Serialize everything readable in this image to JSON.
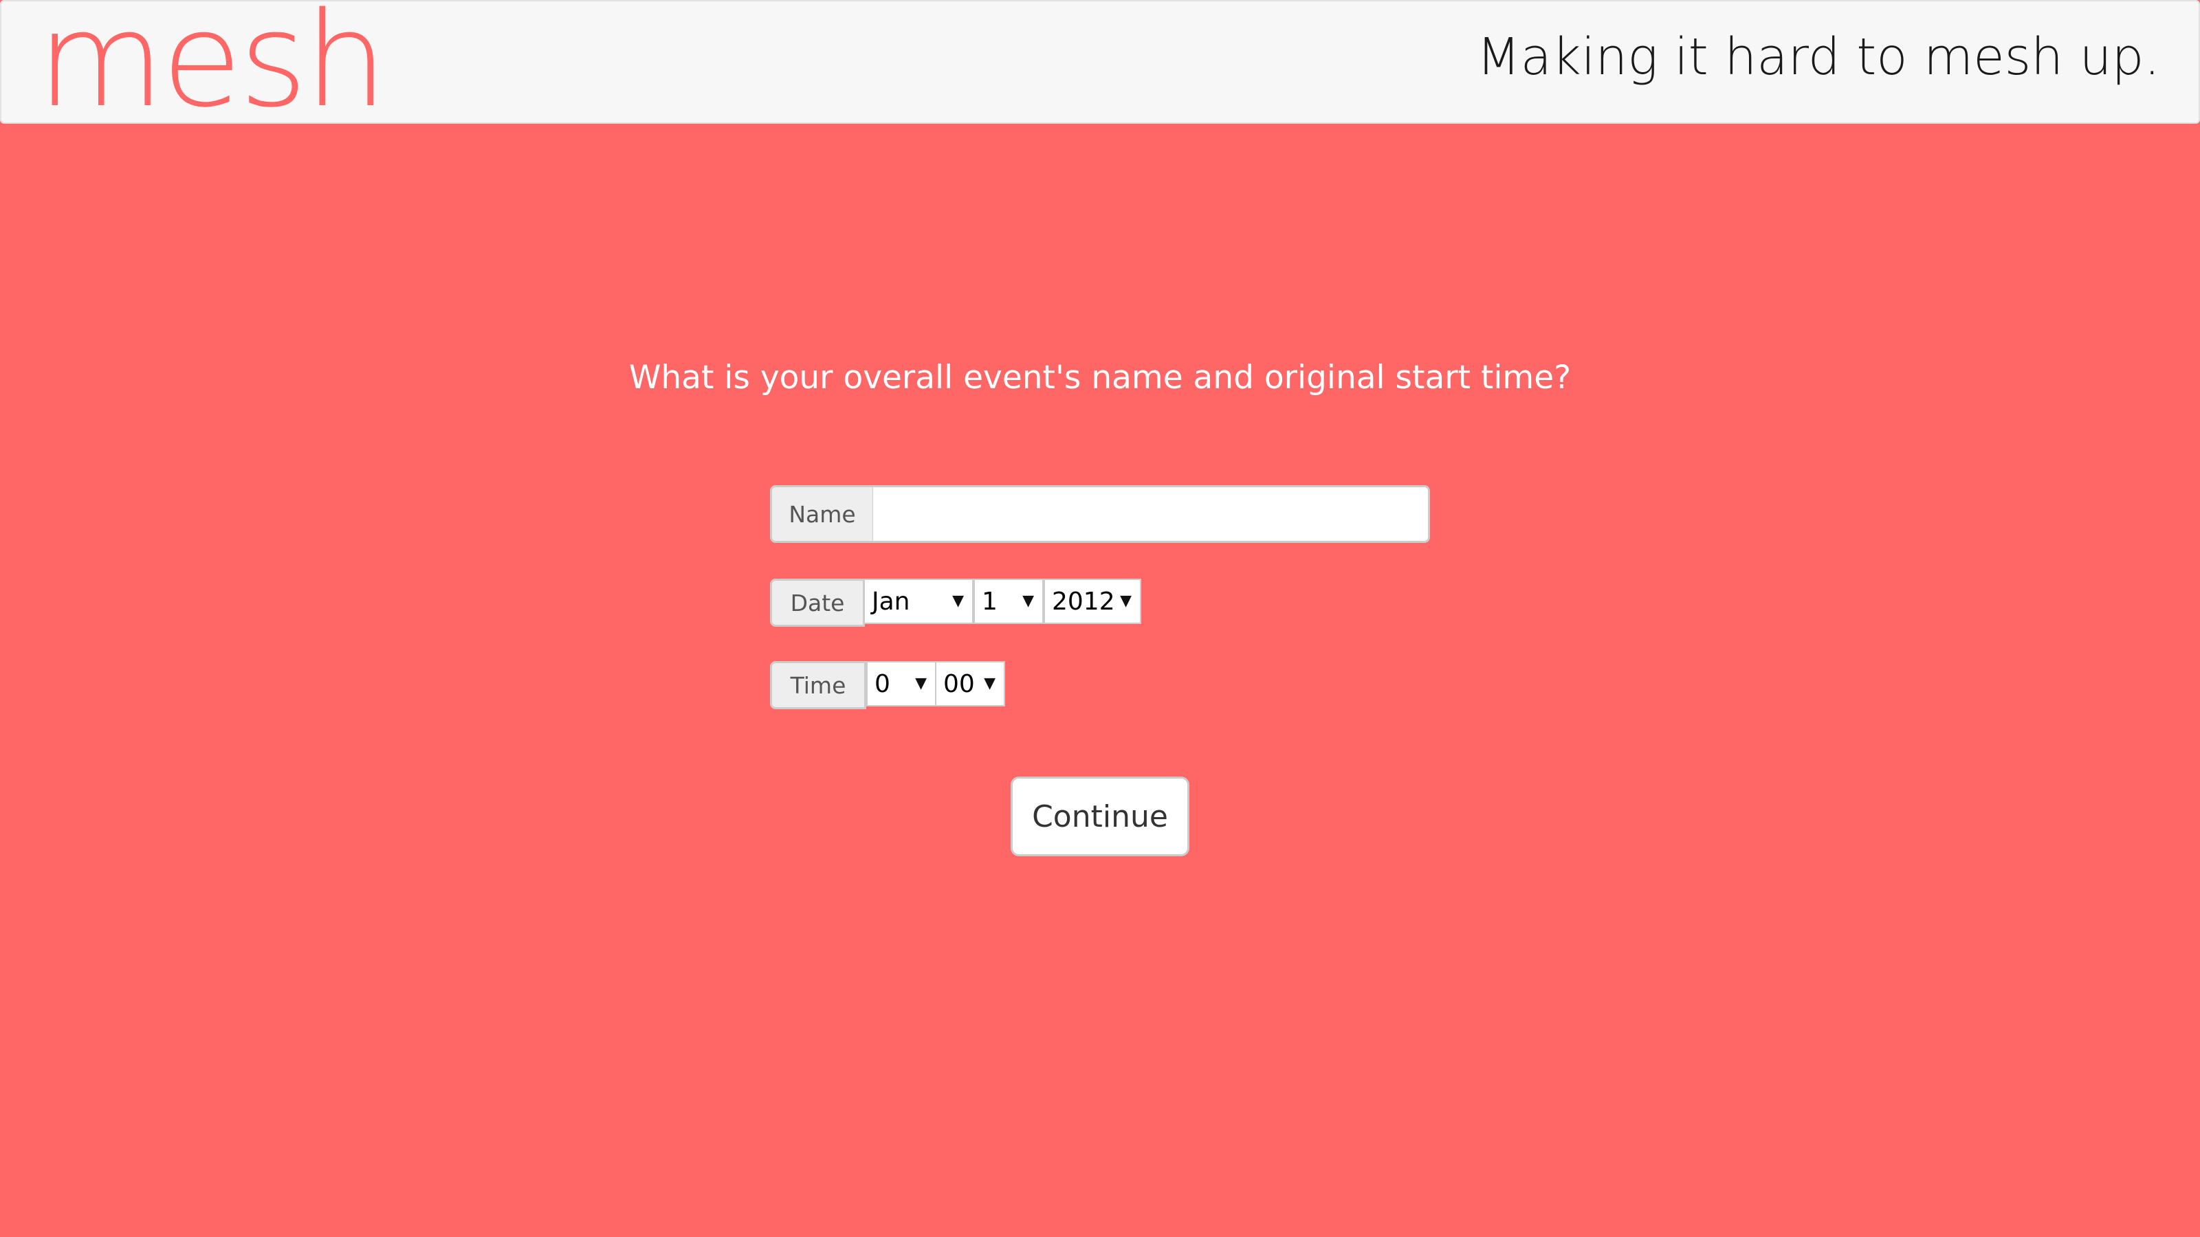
{
  "header": {
    "logo_text": "mesh",
    "tagline": "Making it hard to mesh up."
  },
  "main": {
    "question": "What is your overall event's name and original start time?"
  },
  "form": {
    "name": {
      "label": "Name",
      "value": "",
      "placeholder": ""
    },
    "date": {
      "label": "Date",
      "month": "Jan",
      "day": "1",
      "year": "2012"
    },
    "time": {
      "label": "Time",
      "hour": "0",
      "minute": "00"
    },
    "continue_label": "Continue"
  },
  "icons": {
    "dropdown_arrow": "▼"
  },
  "colors": {
    "background": "#ff6666",
    "navbar": "#f7f7f7",
    "brand": "#ff6666"
  }
}
